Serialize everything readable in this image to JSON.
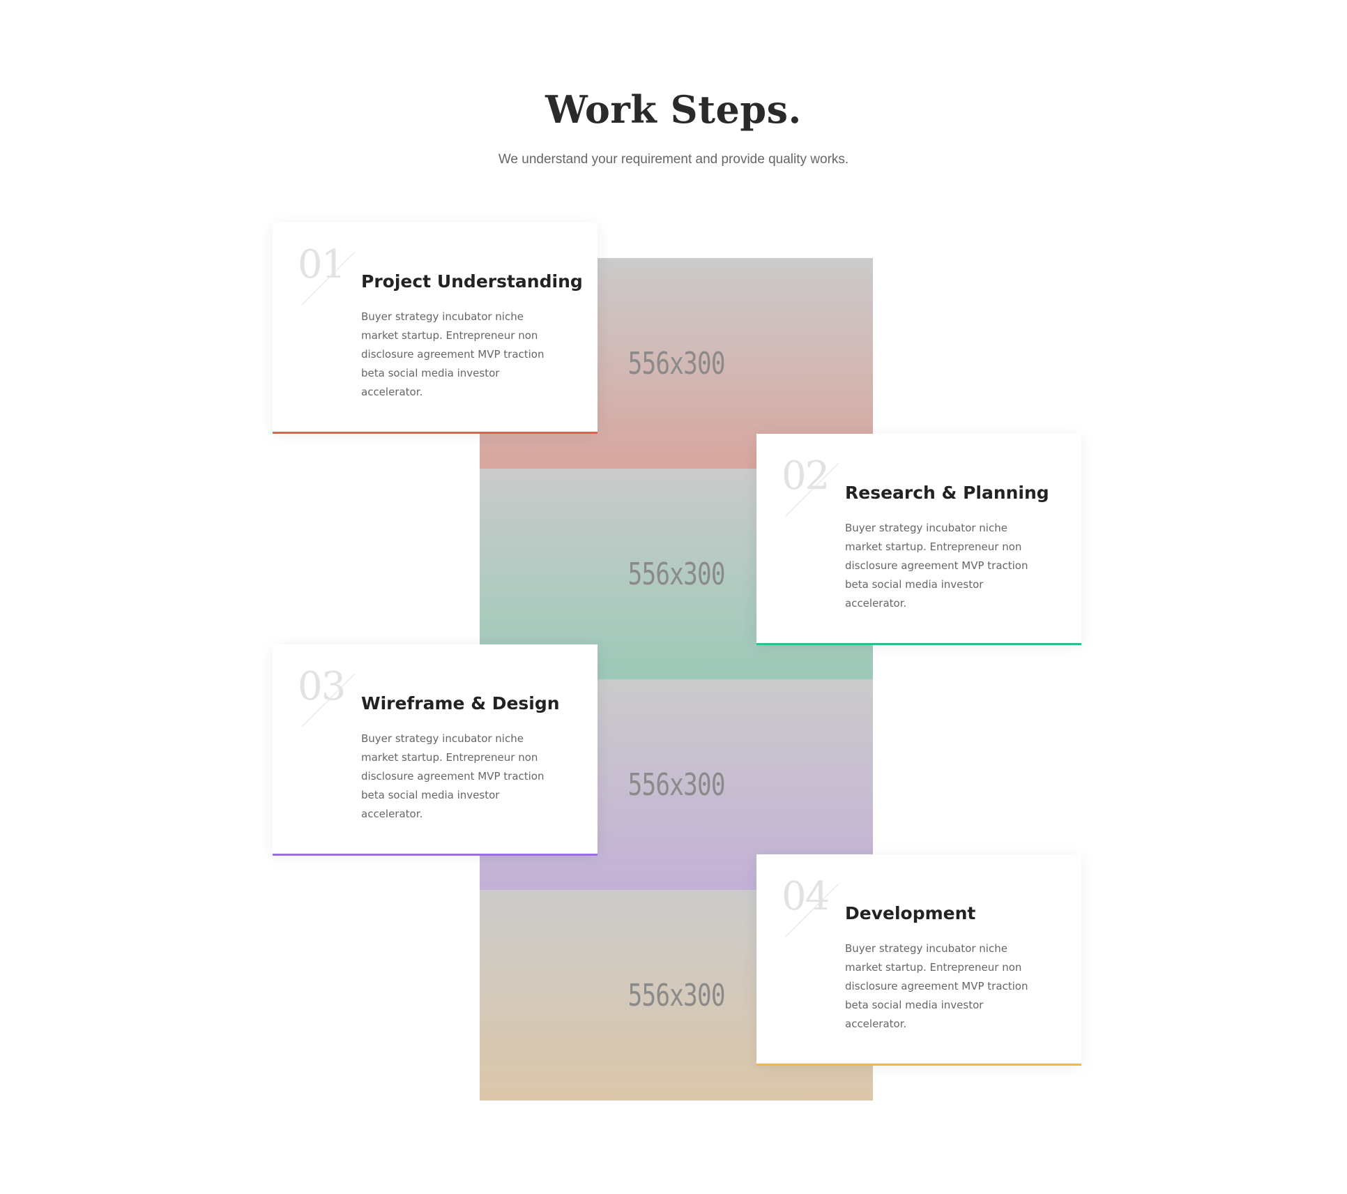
{
  "header": {
    "title": "Work Steps.",
    "subtitle": "We understand your requirement and provide quality works."
  },
  "colors": {
    "step1_accent": "#e85d50",
    "step2_accent": "#2ebd8f",
    "step3_accent": "#9b6ee6",
    "step4_accent": "#f6b44c",
    "step1_tint": "#d8a69f",
    "step2_tint": "#9cc9b8",
    "step3_tint": "#c3b1d6",
    "step4_tint": "#dcc7aa",
    "placeholder_gray": "#cbcbcb"
  },
  "images": [
    {
      "label": "556x300"
    },
    {
      "label": "556x300"
    },
    {
      "label": "556x300"
    },
    {
      "label": "556x300"
    }
  ],
  "steps": [
    {
      "number": "01",
      "title": "Project Understanding",
      "text": "Buyer strategy incubator niche market startup. Entrepreneur non disclosure agreement MVP traction beta social media investor accelerator."
    },
    {
      "number": "02",
      "title": "Research & Planning",
      "text": "Buyer strategy incubator niche market startup. Entrepreneur non disclosure agreement MVP traction beta social media investor accelerator."
    },
    {
      "number": "03",
      "title": "Wireframe & Design",
      "text": "Buyer strategy incubator niche market startup. Entrepreneur non disclosure agreement MVP traction beta social media investor accelerator."
    },
    {
      "number": "04",
      "title": "Development",
      "text": "Buyer strategy incubator niche market startup. Entrepreneur non disclosure agreement MVP traction beta social media investor accelerator."
    }
  ]
}
